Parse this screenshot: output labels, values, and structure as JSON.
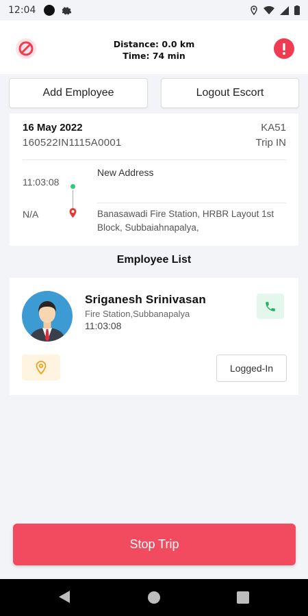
{
  "status_bar": {
    "time": "12:04"
  },
  "header": {
    "distance": "Distance: 0.0 km",
    "time": "Time: 74 min"
  },
  "actions": {
    "add_employee": "Add Employee",
    "logout_escort": "Logout Escort"
  },
  "trip": {
    "date": "16 May 2022",
    "vehicle": "KA51",
    "trip_id": "160522IN1115A0001",
    "trip_type": "Trip IN",
    "pickup_time": "11:03:08",
    "pickup_address": "New Address",
    "drop_time": "N/A",
    "drop_address": "Banasawadi Fire Station, HRBR Layout 1st Block, Subbaiahnapalya,"
  },
  "employee_list": {
    "title": "Employee List",
    "employees": [
      {
        "name": "Sriganesh Srinivasan",
        "location": "Fire Station,Subbanapalya",
        "time": "11:03:08",
        "status": "Logged-In"
      }
    ]
  },
  "footer": {
    "stop_trip": "Stop Trip"
  },
  "colors": {
    "accent": "#f24a5e",
    "green": "#2ecc71",
    "alert": "#f03c52",
    "warning_bg": "#fff4e0",
    "phone_bg": "#e4f7ec"
  },
  "icons": [
    "do-not-disturb-icon",
    "alert-icon",
    "map-pin-icon",
    "phone-icon",
    "location-icon",
    "avatar"
  ]
}
